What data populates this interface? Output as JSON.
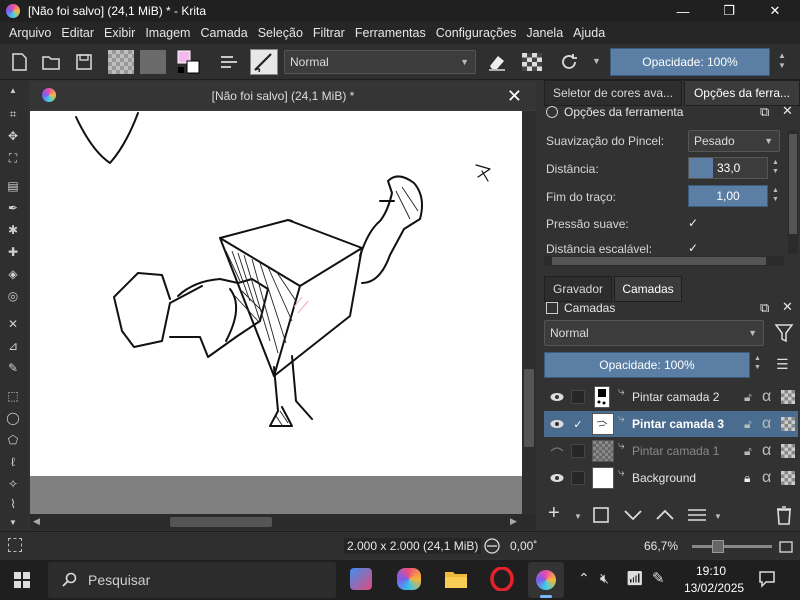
{
  "window": {
    "title": "[Não foi salvo]  (24,1 MiB) * - Krita",
    "minimize": "—",
    "maximize": "❐",
    "close": "✕"
  },
  "menu": [
    "Arquivo",
    "Editar",
    "Exibir",
    "Imagem",
    "Camada",
    "Seleção",
    "Filtrar",
    "Ferramentas",
    "Configurações",
    "Janela",
    "Ajuda"
  ],
  "toolbar": {
    "blend_mode": "Normal",
    "opacity": "Opacidade: 100%"
  },
  "canvas": {
    "title": "[Não foi salvo]  (24,1 MiB) *",
    "close": "✕"
  },
  "tool_options": {
    "tabs": [
      "Seletor de cores ava...",
      "Opções da ferra..."
    ],
    "header": "Opções da ferramenta",
    "smoothing_label": "Suavização do Pincel:",
    "smoothing_value": "Pesado",
    "distance_label": "Distância:",
    "distance_value": "33,0",
    "stroke_end_label": "Fim do traço:",
    "stroke_end_value": "1,00",
    "smooth_pressure_label": "Pressão suave:",
    "scalable_distance_label": "Distância escalável:",
    "check": "✓"
  },
  "layers": {
    "tabs": [
      "Gravador",
      "Camadas"
    ],
    "header": "Camadas",
    "blend_mode": "Normal",
    "opacity": "Opacidade:  100%",
    "items": [
      {
        "name": "Pintar camada 2"
      },
      {
        "name": "Pintar camada 3",
        "check": "✓"
      },
      {
        "name": "Pintar camada 1"
      },
      {
        "name": "Background"
      }
    ],
    "alpha": "α"
  },
  "status": {
    "size": "2.000 x 2.000 (24,1 MiB)",
    "rotation": "0,00˚",
    "zoom": "66,7%"
  },
  "taskbar": {
    "search_placeholder": "Pesquisar",
    "time": "19:10",
    "date": "13/02/2025"
  }
}
